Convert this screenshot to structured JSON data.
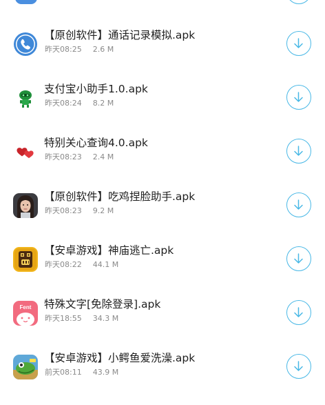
{
  "colors": {
    "accent": "#49b8e6",
    "title_text": "#1f1f1f",
    "meta_text": "#8a8a8a"
  },
  "files": [
    {
      "name": "【原创软件】通话记录模拟.apk",
      "time": "昨天08:25",
      "size": "2.6 M",
      "icon": "phone-icon"
    },
    {
      "name": "支付宝小助手1.0.apk",
      "time": "昨天08:24",
      "size": "8.2 M",
      "icon": "green-robot-icon"
    },
    {
      "name": "特别关心查询4.0.apk",
      "time": "昨天08:23",
      "size": "2.4 M",
      "icon": "hearts-icon"
    },
    {
      "name": "【原创软件】吃鸡捏脸助手.apk",
      "time": "昨天08:23",
      "size": "9.2 M",
      "icon": "character-face-icon"
    },
    {
      "name": "【安卓游戏】神庙逃亡.apk",
      "time": "昨天08:22",
      "size": "44.1 M",
      "icon": "temple-run-icon"
    },
    {
      "name": "特殊文字[免除登录].apk",
      "time": "昨天18:55",
      "size": "34.3 M",
      "icon": "font-app-icon"
    },
    {
      "name": "【安卓游戏】小鳄鱼爱洗澡.apk",
      "time": "前天08:11",
      "size": "43.9 M",
      "icon": "crocodile-game-icon"
    }
  ],
  "font_icon_text": "Fent"
}
